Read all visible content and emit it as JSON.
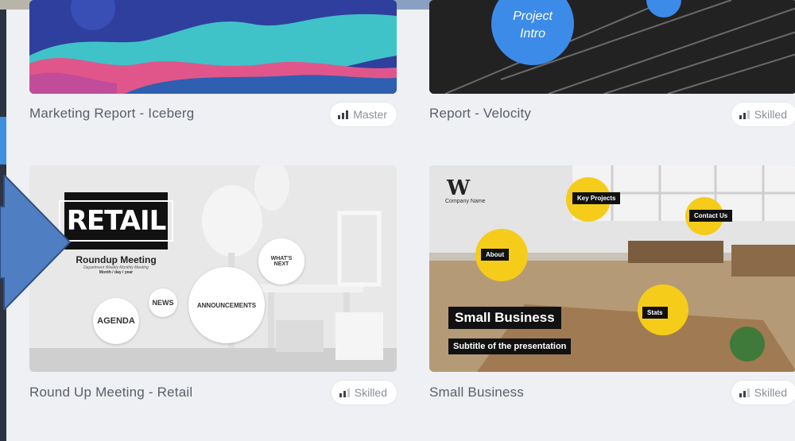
{
  "cards": [
    {
      "title": "Marketing Report - Iceberg",
      "level": "Master"
    },
    {
      "title": "Report - Velocity",
      "level": "Skilled",
      "thumb_text_1": "Project",
      "thumb_text_2": "Intro"
    },
    {
      "title": "Round Up Meeting - Retail",
      "level": "Skilled",
      "thumb": {
        "retail": "RETAIL",
        "meeting": "Roundup Meeting",
        "sub": "Department Weekly Monthly Meeting",
        "date": "Month / day / year",
        "agenda": "AGENDA",
        "news": "NEWS",
        "announcements": "ANNOUNCEMENTS",
        "whats_next_1": "WHAT'S",
        "whats_next_2": "NEXT"
      }
    },
    {
      "title": "Small Business",
      "level": "Skilled",
      "thumb": {
        "company": "Company Name",
        "headline": "Small Business",
        "subtitle": "Subtitle of the presentation",
        "key_projects": "Key Projects",
        "contact_us": "Contact Us",
        "about": "About",
        "stats": "Stats"
      }
    }
  ],
  "colors": {
    "accent_blue": "#4f7fc2",
    "yellow": "#f5cc1a",
    "background": "#eef0f4"
  },
  "icons": {
    "level": "bar-chart-icon",
    "pointer": "arrow-right-icon"
  }
}
